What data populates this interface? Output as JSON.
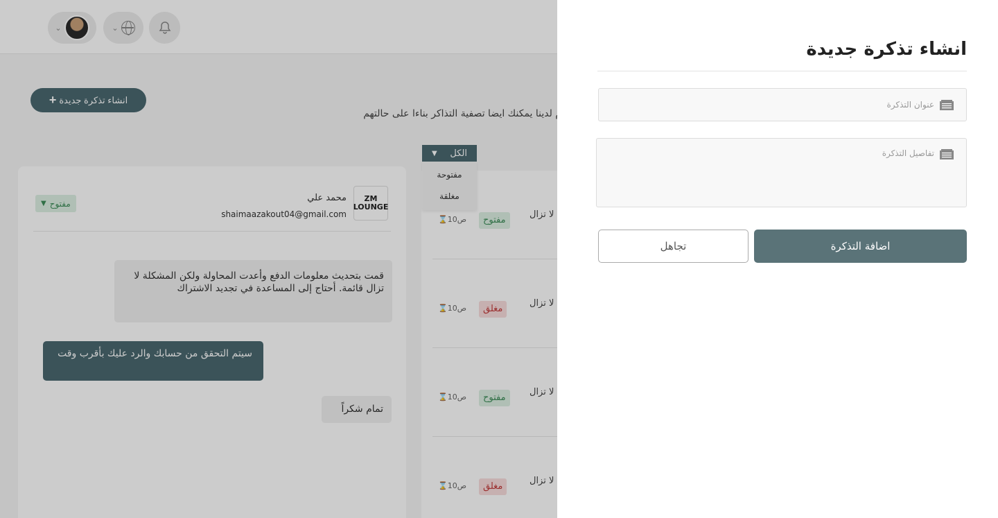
{
  "header": {
    "profile_chevron": "⌄",
    "lang_chevron": "⌄",
    "icons": [
      "avatar",
      "globe-icon",
      "bell-icon"
    ]
  },
  "page": {
    "new_ticket_button": "انشاء تذكرة جديدة",
    "new_ticket_plus": "+",
    "hint_text": "م لدينا يمكنك ايضا تصفية التذاكر بناءا على حالتهم"
  },
  "filter": {
    "selected": "الكل",
    "options": [
      "مفتوحة",
      "مغلقة"
    ]
  },
  "chat": {
    "logo_text": "ZM LOUNGE",
    "user_name": "محمد علي",
    "user_email": "shaimaazakout04@gmail.com",
    "status": "مفتوح",
    "messages": [
      "قمت بتحديث معلومات الدفع وأعدت المحاولة ولكن المشكلة لا تزال قائمة. أحتاج إلى المساعدة في تجديد الاشتراك",
      "سيتم التحقق من حسابك والرد عليك بأقرب وقت",
      "تمام شكراً"
    ]
  },
  "tickets": [
    {
      "time": "⌛10ص",
      "status": "مفتوح",
      "text": "لا تزال"
    },
    {
      "time": "⌛10ص",
      "status": "مغلق",
      "text": "لا تزال"
    },
    {
      "time": "⌛10ص",
      "status": "مفتوح",
      "text": "لا تزال"
    },
    {
      "time": "⌛10ص",
      "status": "مغلق",
      "text": "لا تزال"
    }
  ],
  "drawer": {
    "title": "انشاء تذكرة جديدة",
    "title_placeholder": "عنوان التذكرة",
    "details_placeholder": "تفاصيل التذكرة",
    "add_button": "اضافة التذكرة",
    "ignore_button": "تجاهل"
  },
  "colors": {
    "primary": "#4a6870",
    "button": "#5a7378",
    "open_bg": "#dcefe3",
    "open_text": "#3c8c58",
    "closed_bg": "#f8dcdc",
    "closed_text": "#c23b3b"
  }
}
